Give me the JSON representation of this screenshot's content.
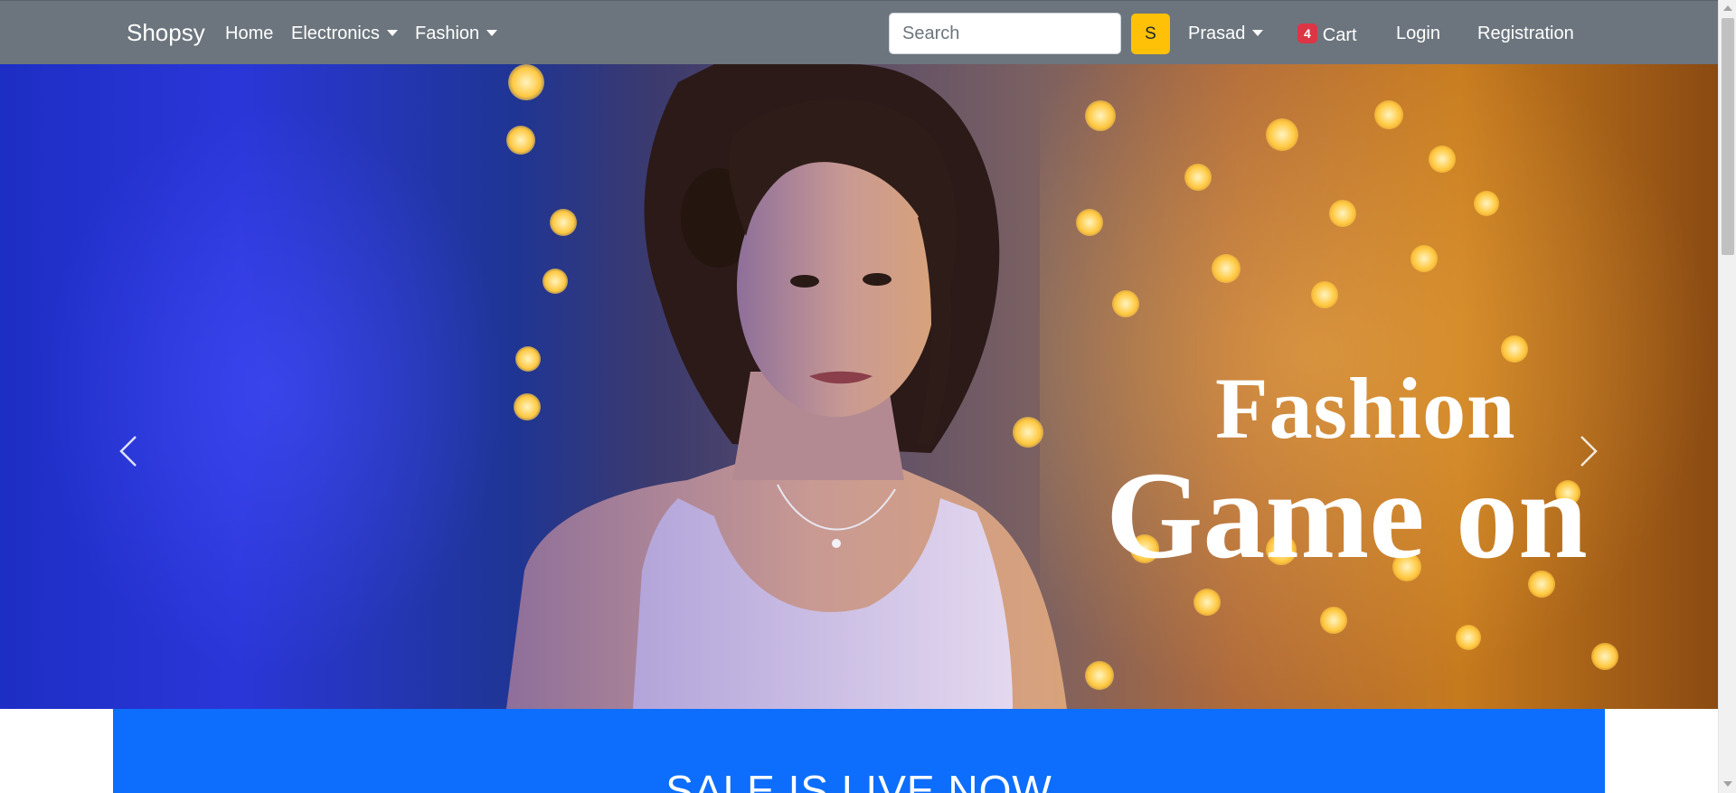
{
  "navbar": {
    "brand": "Shopsy",
    "links": {
      "home": "Home",
      "electronics": "Electronics",
      "fashion": "Fashion"
    },
    "search": {
      "placeholder": "Search",
      "button_label": "S"
    },
    "user_menu": "Prasad",
    "cart": {
      "count": "4",
      "label": "Cart"
    },
    "login": "Login",
    "registration": "Registration"
  },
  "hero": {
    "caption_line1": "Fashion",
    "caption_line2": "Game on",
    "controls": {
      "prev_icon": "chevron-left-icon",
      "next_icon": "chevron-right-icon"
    }
  },
  "sale_banner": {
    "text": "SALE IS LIVE NOW"
  },
  "colors": {
    "navbar": "#6c757d",
    "search_button": "#ffc107",
    "cart_badge": "#dc3545",
    "sale_banner": "#0d6efd"
  }
}
